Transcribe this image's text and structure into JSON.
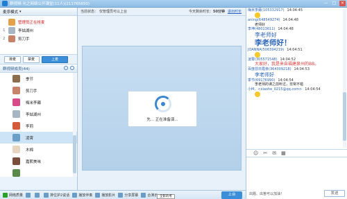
{
  "window": {
    "title": "群视频-允之网络公开课堂(11人)(211765650)",
    "controls": [
      "—",
      "□",
      "×"
    ]
  },
  "left": {
    "mode_label": "麦序模式",
    "mic_queue": [
      {
        "num": "",
        "label": "管理员正在抢麦",
        "style": "red",
        "avatar": "#e3a24a"
      },
      {
        "num": "1",
        "label": "李姑湖州",
        "style": "",
        "avatar": "#a8b5c4"
      },
      {
        "num": "2",
        "label": "剪刀手",
        "style": "",
        "avatar": "#c9826a"
      }
    ],
    "tabs": [
      "排麦",
      "禁麦",
      "上麦"
    ],
    "members_header": "群视频成员(44)",
    "members": [
      {
        "name": "季节",
        "avatar": "#8c6d4e"
      },
      {
        "name": "剪刀手",
        "avatar": "#c9826a"
      },
      {
        "name": "梅米李薅",
        "avatar": "#d84a8a"
      },
      {
        "name": "李姑湖州",
        "avatar": "#a8b5c4"
      },
      {
        "name": "李莉",
        "avatar": "#d45a3a"
      },
      {
        "name": "凌霄",
        "avatar": "#6aa0c8"
      },
      {
        "name": "木棉",
        "avatar": "#e8d5c0"
      },
      {
        "name": "嘉熙美味",
        "avatar": "#7a4e3a"
      },
      {
        "name": "",
        "avatar": "#5a8a4a"
      }
    ],
    "selected_member_index": 5
  },
  "center": {
    "status_label": "当前状态：",
    "status_value": "仅管理员可以上台",
    "remaining_label": "今天剩余时长：",
    "remaining_value": "50分钟",
    "exit_link": "退出时长",
    "loading_text": "先... 正在准备演..."
  },
  "chat": {
    "messages": [
      {
        "name": "梅米李薅(105332917)",
        "time": "14:04:45",
        "text": "",
        "style": "emoji"
      },
      {
        "name": "aning(648549274)",
        "time": "14:04:48",
        "text": "老师好",
        "style": ""
      },
      {
        "name": "李坤(48013611)",
        "time": "14:04:48",
        "text": "李老师好",
        "style": "blue"
      },
      {
        "name": "",
        "time": "",
        "text": "李老师好！",
        "style": "big"
      },
      {
        "name": "JOANNA(506394219)",
        "time": "14:04:51",
        "text": "",
        "style": "emoji2"
      },
      {
        "name": "凌霄(305571548)",
        "time": "14:04:52",
        "text": "大家好，我是来自福建泉州的BB。",
        "style": "red"
      },
      {
        "name": "百度前日霞亲(364309218)",
        "time": "14:04:53",
        "text": "李老师好",
        "style": "blue2"
      },
      {
        "name": "季节(69176990)",
        "time": "14:04:54",
        "text": "李老师的课之前听过，非常不错",
        "style": ""
      },
      {
        "name": "小M、<xiaohe_0215@qq.com>",
        "time": "14:04:54",
        "text": "",
        "style": "emoji"
      }
    ],
    "toolbar_icons": [
      "☺",
      "✂",
      "✉",
      "▦"
    ],
    "footer_text": "出题、出答可以加油！",
    "send_label": "发送"
  },
  "bottombar": {
    "items": [
      {
        "label": "网络质量",
        "icon": "signal-icon"
      },
      {
        "label": "",
        "icon": "mic-icon"
      },
      {
        "label": "",
        "icon": "speaker-icon"
      },
      {
        "label": "排位护2说话",
        "icon": "queue-icon"
      },
      {
        "label": "播放伴奏",
        "icon": "music-icon"
      },
      {
        "label": "播放影片",
        "icon": "film-icon"
      },
      {
        "label": "分享屏幕",
        "icon": "screen-icon"
      },
      {
        "label": "合演示",
        "icon": "present-icon"
      }
    ],
    "up_button": "上台",
    "tooltip": "全影的考"
  },
  "colors": {
    "accent": "#3b8ed8",
    "title_bg": "#8fbde6",
    "panel_bg": "#eaf3fb"
  }
}
